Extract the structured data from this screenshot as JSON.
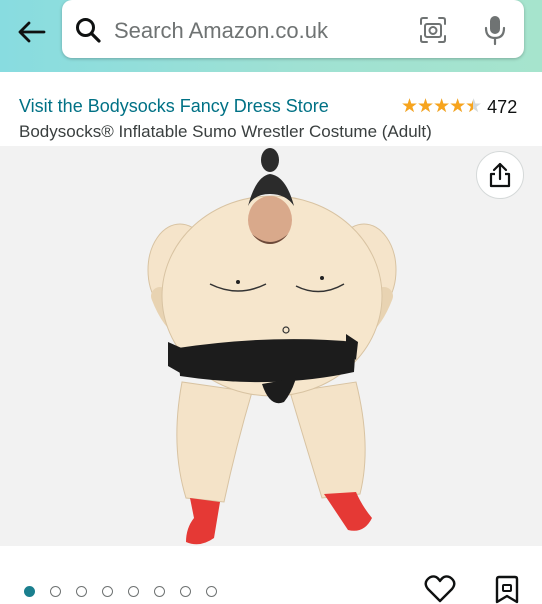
{
  "header": {
    "search_placeholder": "Search Amazon.co.uk",
    "back_icon": "arrow-left-icon",
    "search_icon": "search-icon",
    "lens_icon": "camera-lens-icon",
    "mic_icon": "microphone-icon"
  },
  "product": {
    "store_link": "Visit the Bodysocks Fancy Dress Store",
    "rating": 4.5,
    "rating_max": 5,
    "rating_count": "472",
    "title": "Bodysocks® Inflatable Sumo Wrestler Costume (Adult)"
  },
  "gallery": {
    "image_count": 8,
    "active_index": 0,
    "share_icon": "share-icon",
    "wishlist_icon": "heart-icon",
    "save_icon": "bookmark-icon"
  },
  "colors": {
    "header_gradient_start": "#88dce0",
    "header_gradient_end": "#a6e4cd",
    "link": "#007185",
    "star": "#f7a41d",
    "active_dot": "#1b7f8e"
  }
}
